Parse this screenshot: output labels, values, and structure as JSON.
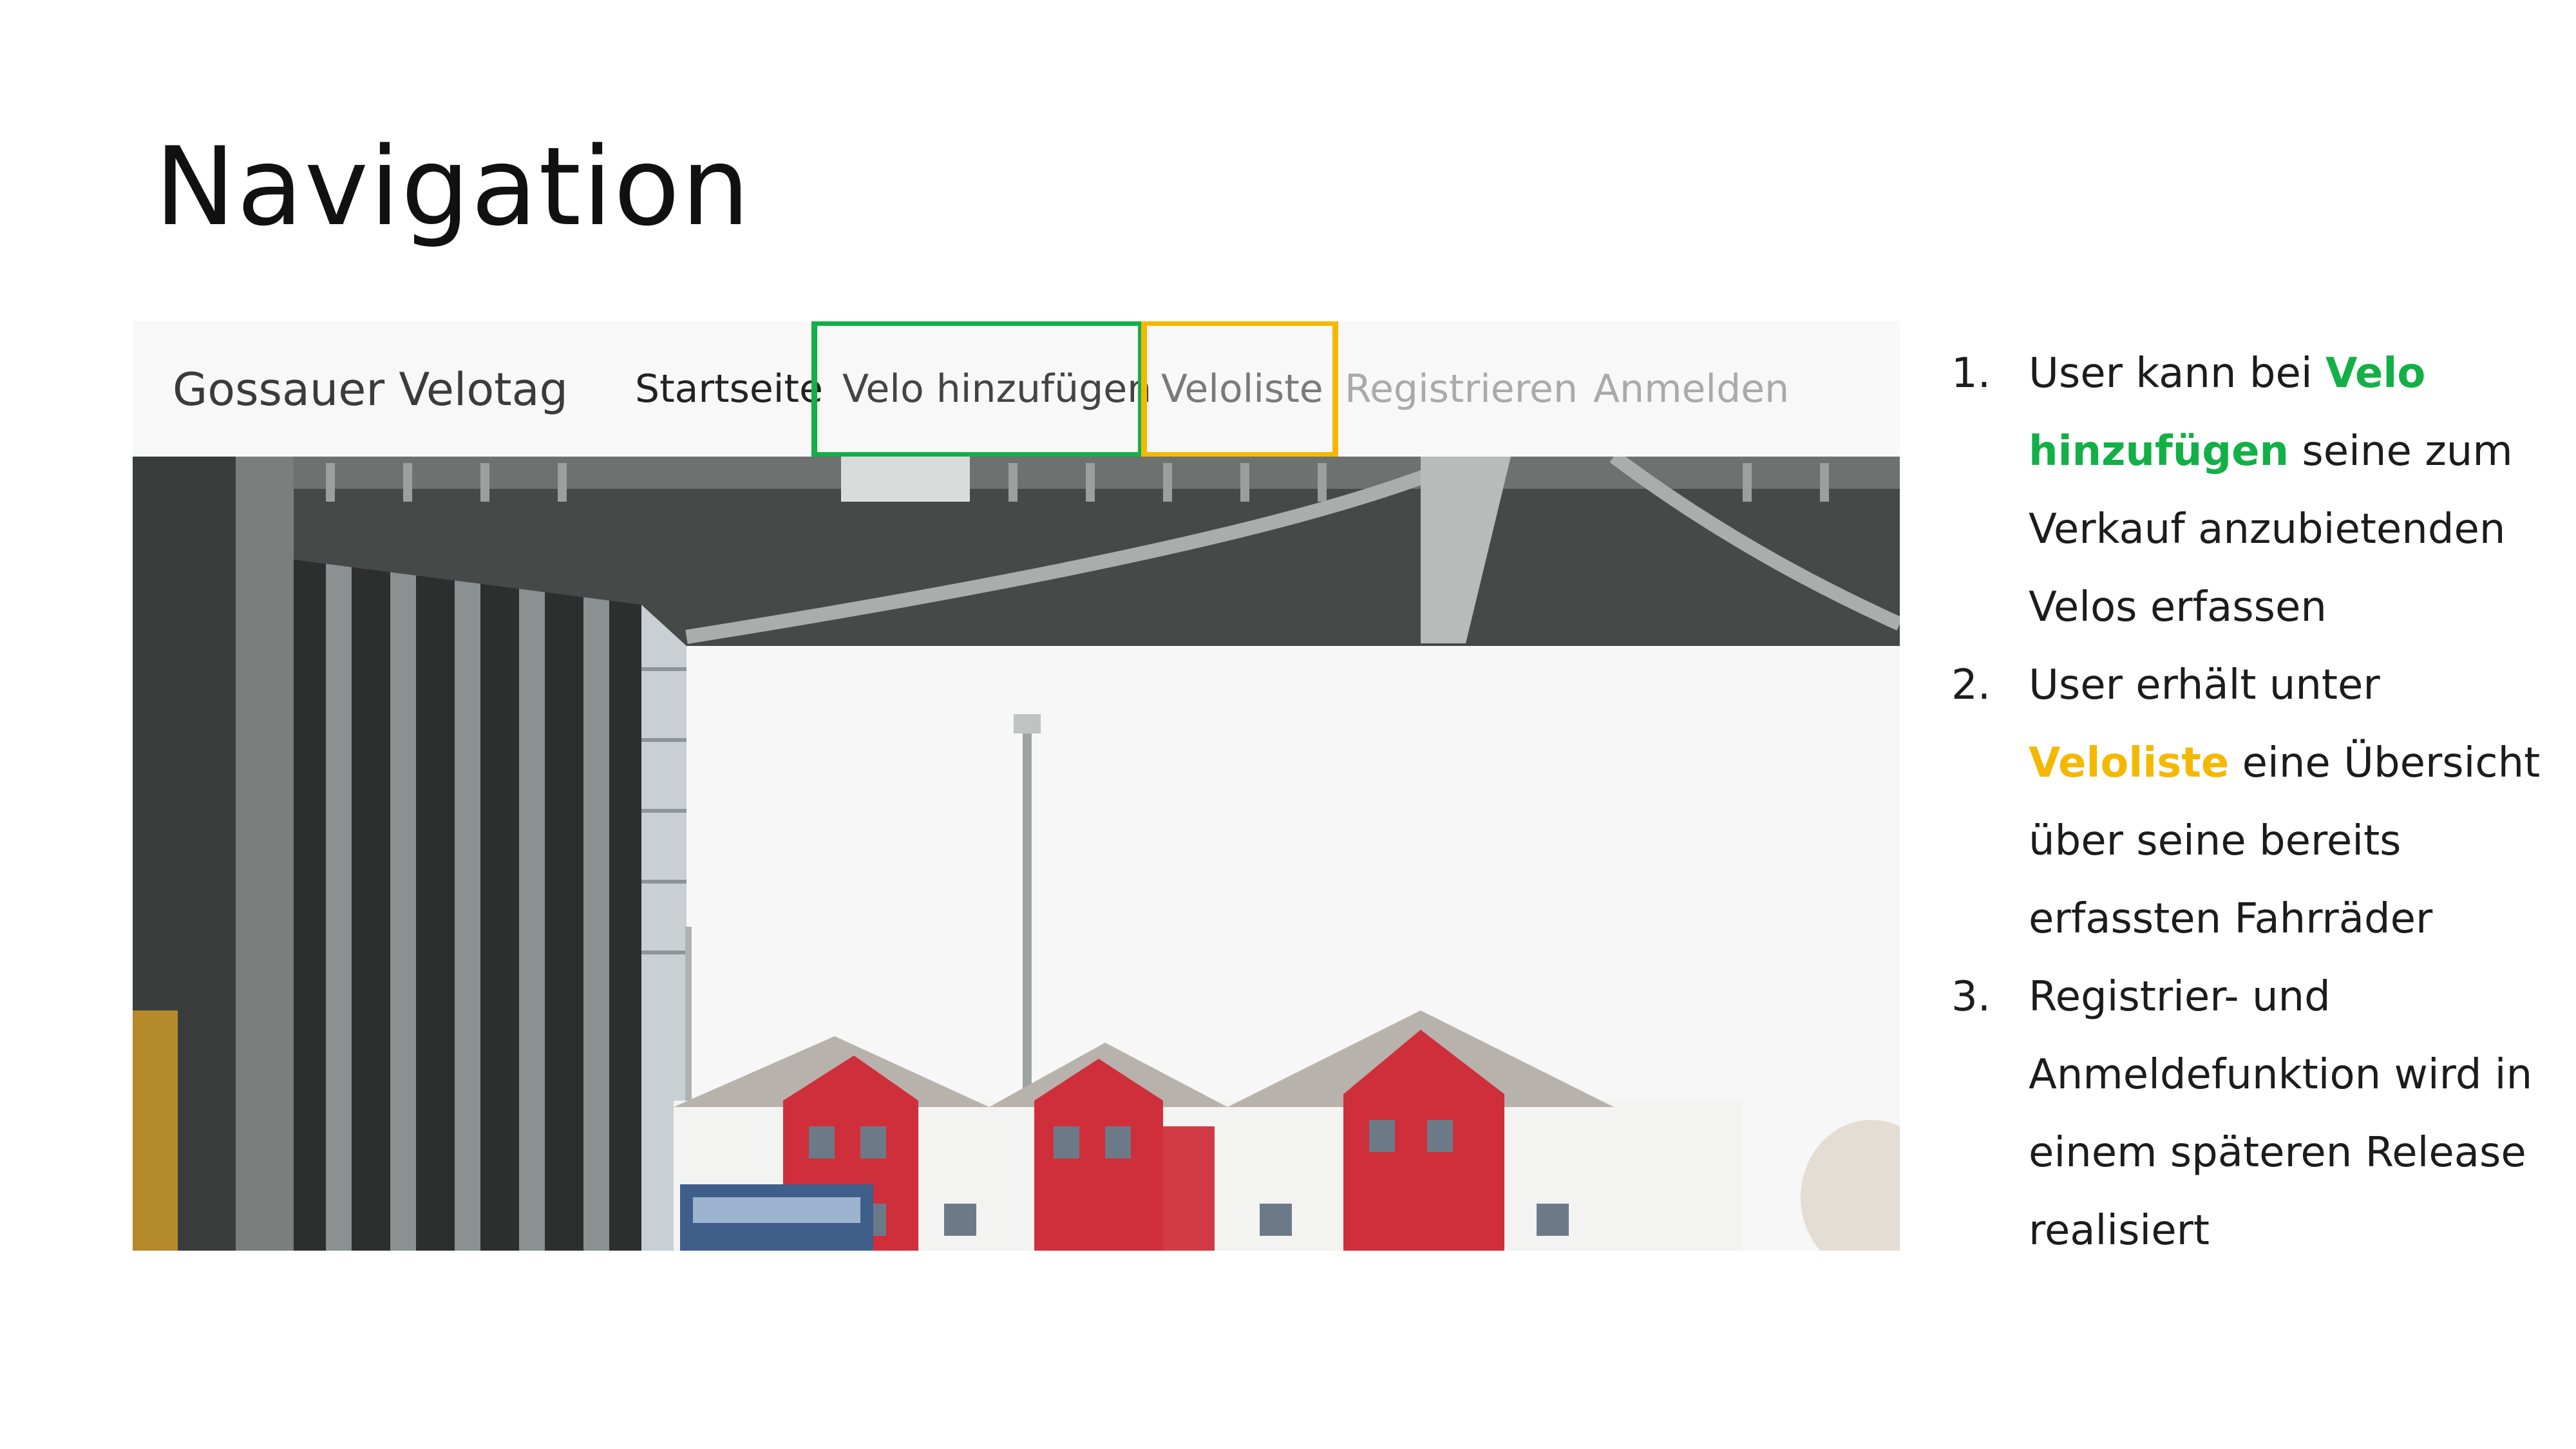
{
  "slide": {
    "title": "Navigation"
  },
  "screenshot": {
    "brand": "Gossauer Velotag",
    "nav": {
      "startseite": "Startseite",
      "velo_hinzufuegen": "Velo hinzufügen",
      "veloliste": "Veloliste",
      "registrieren": "Registrieren",
      "anmelden": "Anmelden"
    },
    "highlight_colors": {
      "green": "#12b046",
      "yellow": "#f5b800"
    }
  },
  "notes": [
    {
      "num": "1.",
      "before": "User kann bei ",
      "keyword": "Velo hinzufügen",
      "after": " seine zum Verkauf anzubietenden Velos erfassen"
    },
    {
      "num": "2.",
      "before": "User erhält unter ",
      "keyword": "Veloliste",
      "after": " eine Übersicht über seine bereits erfassten Fahrräder"
    },
    {
      "num": "3.",
      "text": "Registrier- und Anmeldefunktion wird in einem späteren Release realisiert"
    }
  ]
}
